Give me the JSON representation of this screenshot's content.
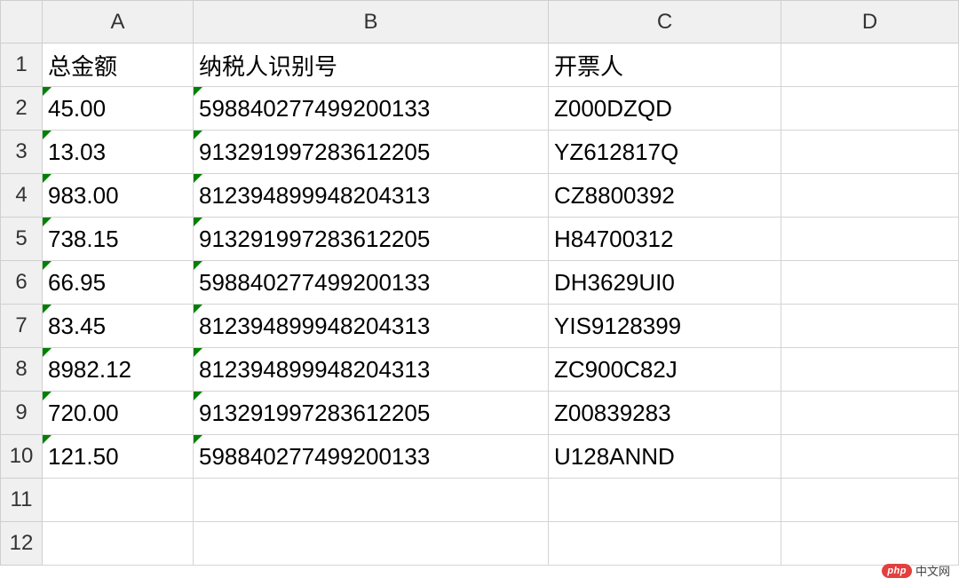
{
  "columns": [
    "A",
    "B",
    "C",
    "D"
  ],
  "rows": [
    "1",
    "2",
    "3",
    "4",
    "5",
    "6",
    "7",
    "8",
    "9",
    "10",
    "11",
    "12"
  ],
  "headers": {
    "A": "总金额",
    "B": "纳税人识别号",
    "C": "开票人"
  },
  "data": [
    {
      "A": "45.00",
      "B": "598840277499200133",
      "C": "Z000DZQD"
    },
    {
      "A": "13.03",
      "B": "913291997283612205",
      "C": "YZ612817Q"
    },
    {
      "A": "983.00",
      "B": "812394899948204313",
      "C": "CZ8800392"
    },
    {
      "A": "738.15",
      "B": "913291997283612205",
      "C": "H84700312"
    },
    {
      "A": "66.95",
      "B": "598840277499200133",
      "C": "DH3629UI0"
    },
    {
      "A": "83.45",
      "B": "812394899948204313",
      "C": "YIS9128399"
    },
    {
      "A": "8982.12",
      "B": "812394899948204313",
      "C": "ZC900C82J"
    },
    {
      "A": "720.00",
      "B": "913291997283612205",
      "C": "Z00839283"
    },
    {
      "A": "121.50",
      "B": "598840277499200133",
      "C": "U128ANND"
    }
  ],
  "watermark": {
    "badge": "php",
    "text": "中文网"
  }
}
